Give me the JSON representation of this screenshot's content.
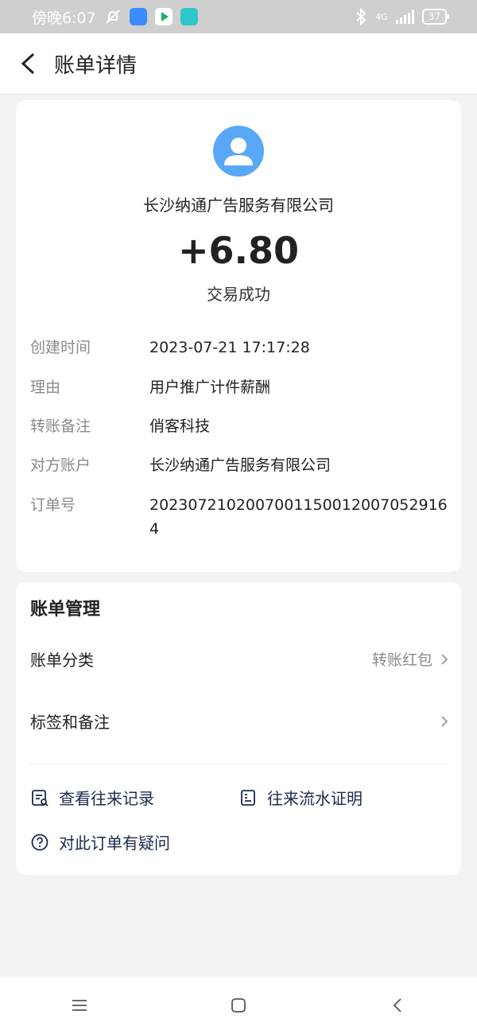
{
  "status_bar": {
    "time": "傍晚6:07",
    "network": "4G",
    "battery": "37",
    "icons": [
      "mute-icon",
      "alipay-icon",
      "play-icon",
      "app-icon",
      "bluetooth-icon",
      "signal-icon",
      "battery-icon"
    ]
  },
  "header": {
    "title": "账单详情"
  },
  "transaction": {
    "counterparty": "长沙纳通广告服务有限公司",
    "amount": "+6.80",
    "status": "交易成功",
    "details": [
      {
        "label": "创建时间",
        "value": "2023-07-21 17:17:28"
      },
      {
        "label": "理由",
        "value": "用户推广计件薪酬"
      },
      {
        "label": "转账备注",
        "value": "俏客科技"
      },
      {
        "label": "对方账户",
        "value": "长沙纳通广告服务有限公司"
      },
      {
        "label": "订单号",
        "value": "20230721020070011500120070529164"
      }
    ]
  },
  "management": {
    "title": "账单管理",
    "category_label": "账单分类",
    "category_value": "转账红包",
    "tags_label": "标签和备注",
    "links": {
      "history": "查看往来记录",
      "statement": "往来流水证明",
      "question": "对此订单有疑问"
    }
  },
  "colors": {
    "avatar": "#59a7f7",
    "background": "#f2f3f5",
    "link": "#1a2b4c"
  }
}
